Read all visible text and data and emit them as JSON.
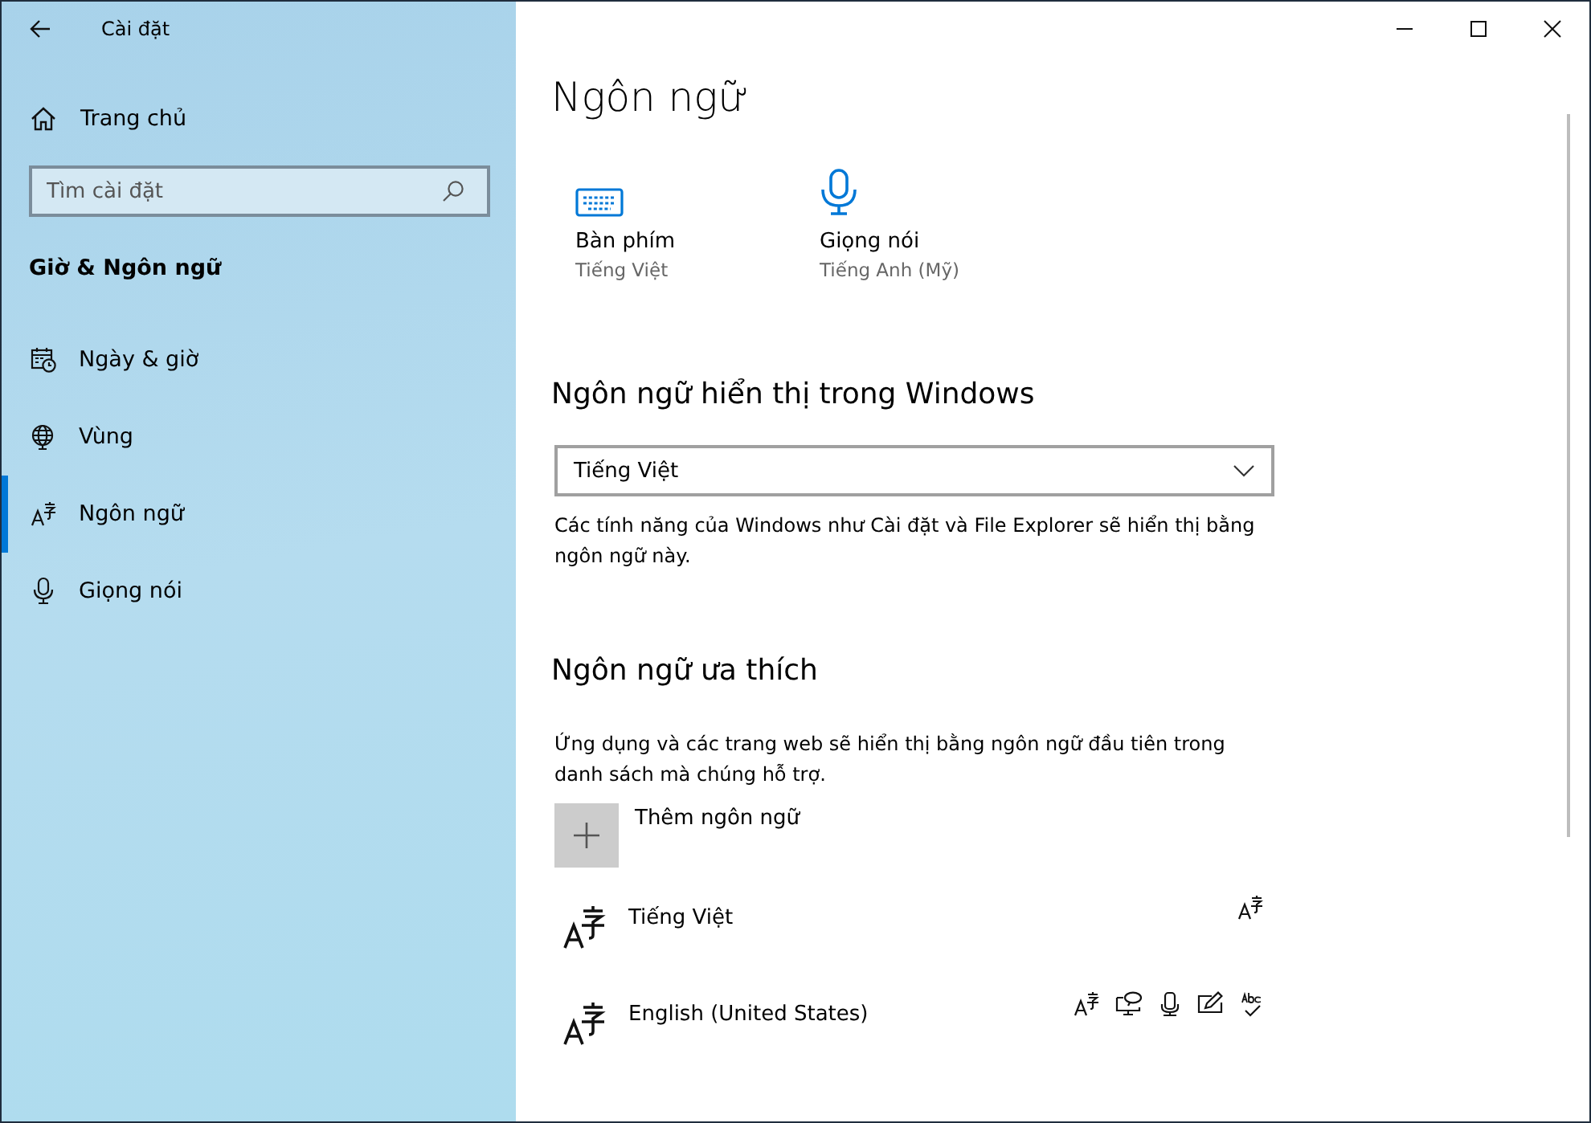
{
  "window": {
    "title": "Cài đặt"
  },
  "sidebar": {
    "home": "Trang chủ",
    "search": {
      "placeholder": "Tìm cài đặt"
    },
    "section_title": "Giờ & Ngôn ngữ",
    "items": [
      {
        "label": "Ngày & giờ",
        "kind": "calendar",
        "selected": false
      },
      {
        "label": "Vùng",
        "kind": "globe",
        "selected": false
      },
      {
        "label": "Ngôn ngữ",
        "kind": "language",
        "selected": true
      },
      {
        "label": "Giọng nói",
        "kind": "mic",
        "selected": false
      }
    ]
  },
  "page": {
    "title": "Ngôn ngữ",
    "tiles": [
      {
        "kind": "keyboard",
        "label": "Bàn phím",
        "value": "Tiếng Việt"
      },
      {
        "kind": "mic",
        "label": "Giọng nói",
        "value": "Tiếng Anh (Mỹ)"
      }
    ],
    "display_language": {
      "heading": "Ngôn ngữ hiển thị trong Windows",
      "dropdown": {
        "value": "Tiếng Việt"
      },
      "description": "Các tính năng của Windows như Cài đặt và File Explorer sẽ hiển thị bằng ngôn ngữ này."
    },
    "preferred": {
      "heading": "Ngôn ngữ ưa thích",
      "description": "Ứng dụng và các trang web sẽ hiển thị bằng ngôn ngữ đầu tiên trong danh sách mà chúng hỗ trợ.",
      "add_button": "Thêm ngôn ngữ",
      "languages": [
        {
          "name": "Tiếng Việt",
          "features": [
            {
              "kind": "display"
            }
          ]
        },
        {
          "name": "English (United States)",
          "features": [
            {
              "kind": "display"
            },
            {
              "kind": "speech"
            },
            {
              "kind": "mic"
            },
            {
              "kind": "handwriting"
            },
            {
              "kind": "spelling"
            }
          ]
        }
      ]
    }
  }
}
